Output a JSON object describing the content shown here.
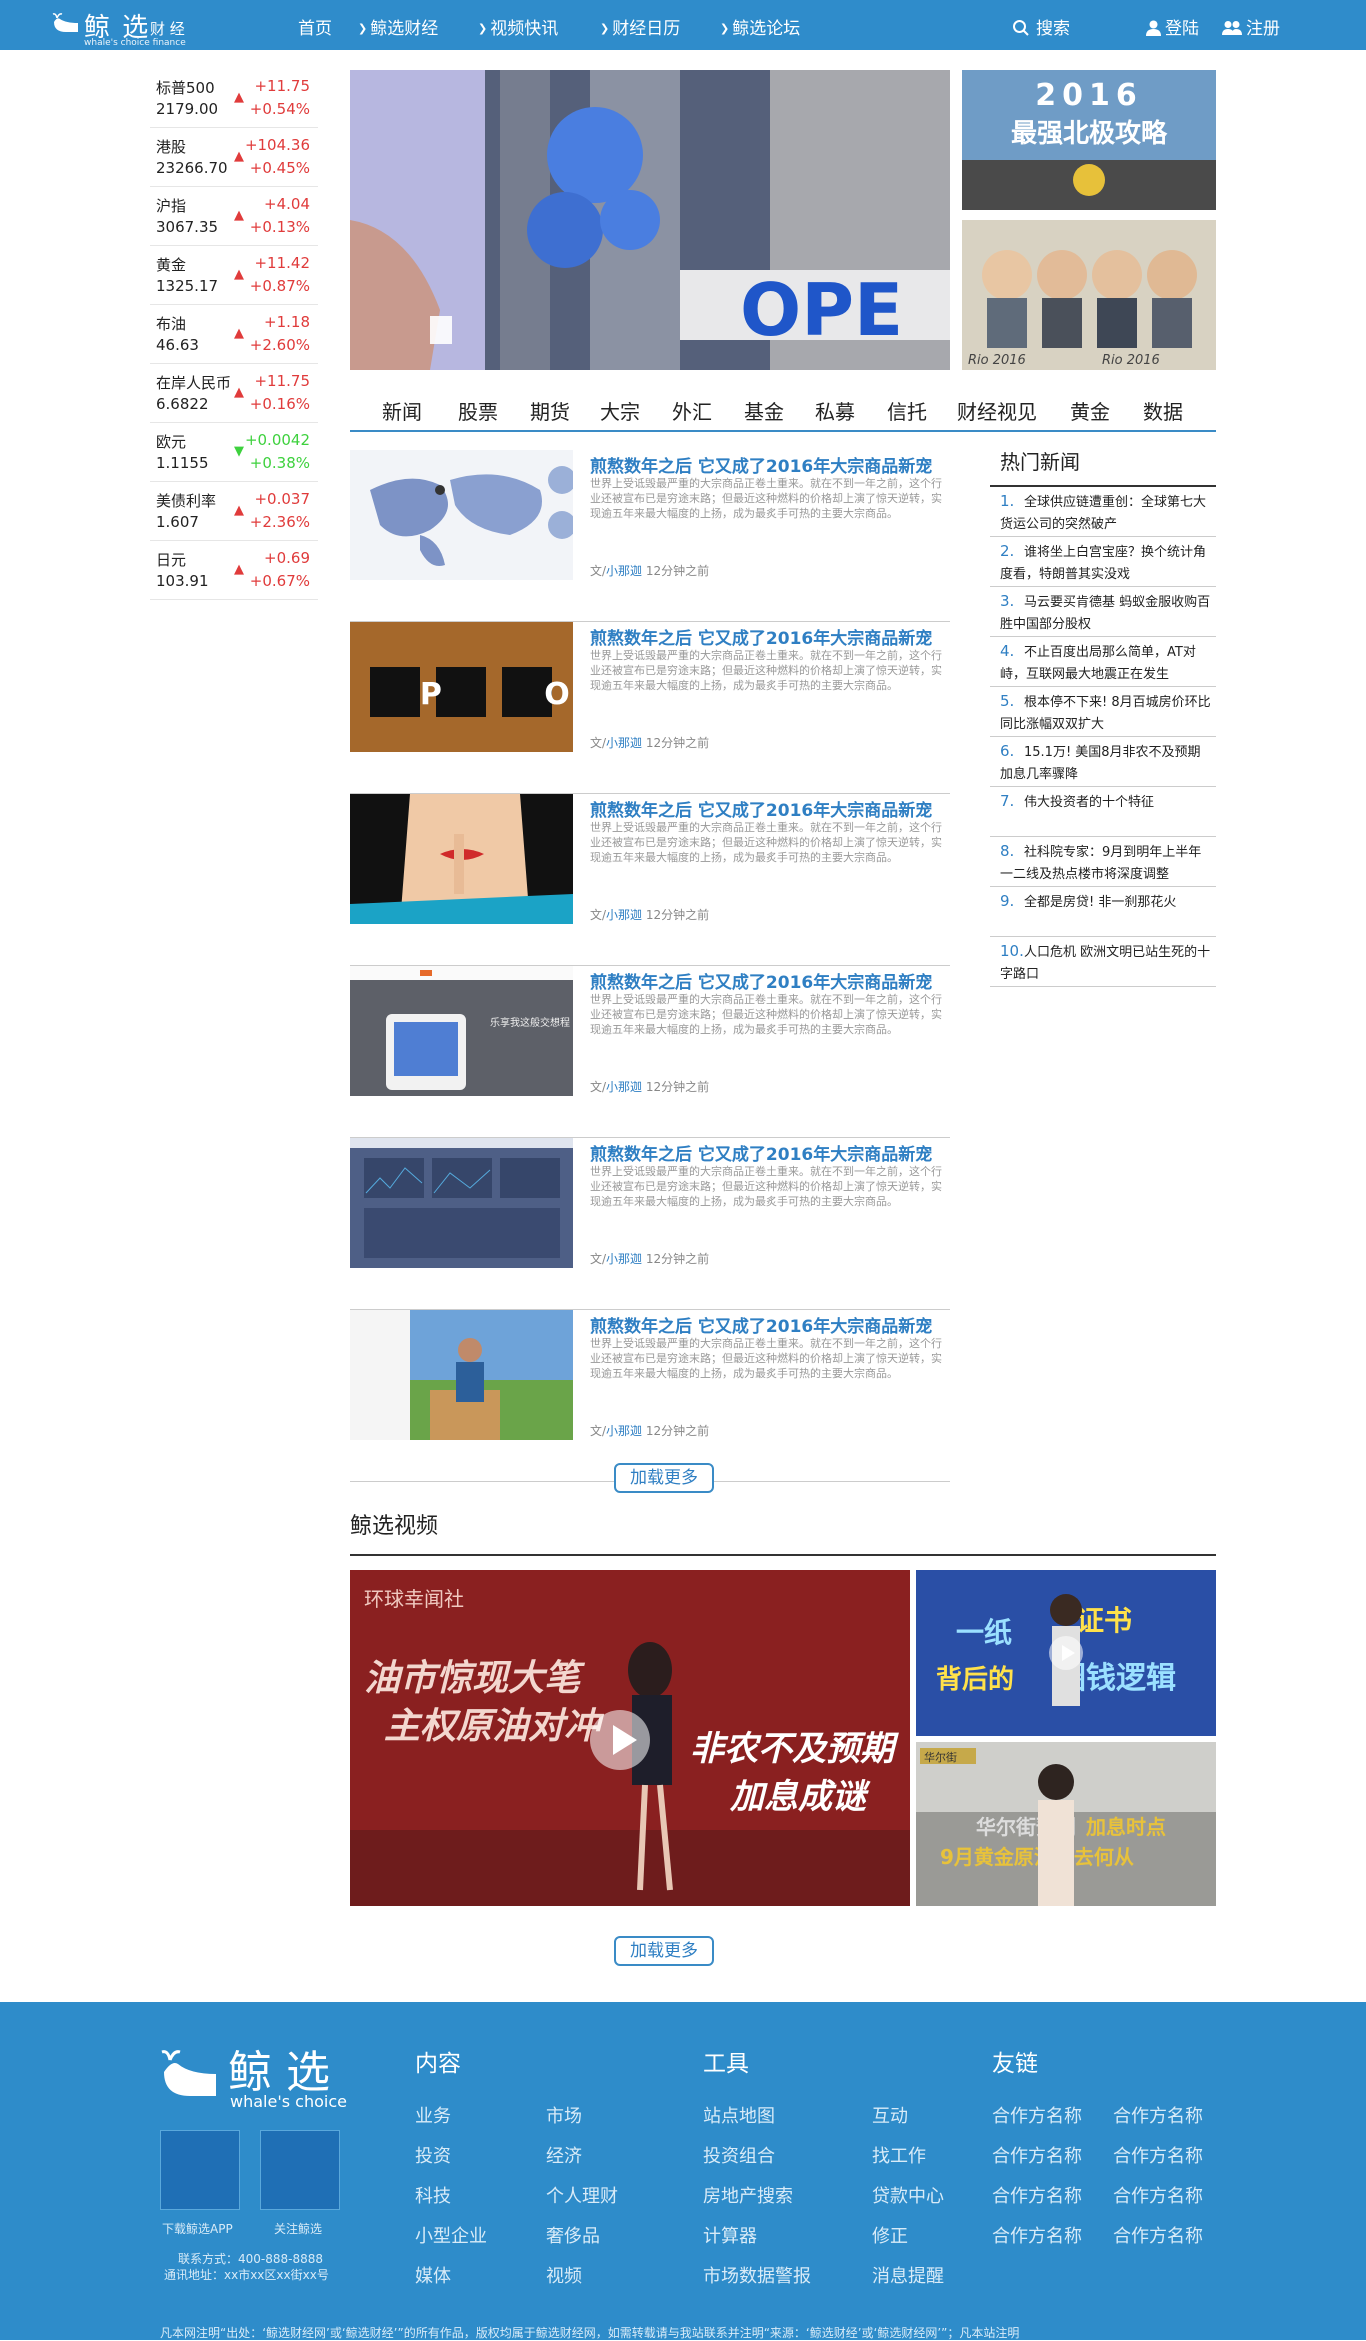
{
  "header": {
    "logo_cn": "鲸 选",
    "logo_sub": "财 经",
    "logo_en": "whale's choice finance",
    "nav": [
      "首页",
      "鲸选财经",
      "视频快讯",
      "财经日历",
      "鲸选论坛"
    ],
    "search": "搜索",
    "login": "登陆",
    "register": "注册"
  },
  "tickers": [
    {
      "name": "标普500",
      "price": "2179.00",
      "chg": "+11.75",
      "pct": "+0.54%",
      "dir": "up"
    },
    {
      "name": "港股",
      "price": "23266.70",
      "chg": "+104.36",
      "pct": "+0.45%",
      "dir": "up"
    },
    {
      "name": "沪指",
      "price": "3067.35",
      "chg": "+4.04",
      "pct": "+0.13%",
      "dir": "up"
    },
    {
      "name": "黄金",
      "price": "1325.17",
      "chg": "+11.42",
      "pct": "+0.87%",
      "dir": "up"
    },
    {
      "name": "布油",
      "price": "46.63",
      "chg": "+1.18",
      "pct": "+2.60%",
      "dir": "up"
    },
    {
      "name": "在岸人民币",
      "price": "6.6822",
      "chg": "+11.75",
      "pct": "+0.16%",
      "dir": "up"
    },
    {
      "name": "欧元",
      "price": "1.1155",
      "chg": "+0.0042",
      "pct": "+0.38%",
      "dir": "down"
    },
    {
      "name": "美债利率",
      "price": "1.607",
      "chg": "+0.037",
      "pct": "+2.36%",
      "dir": "up"
    },
    {
      "name": "日元",
      "price": "103.91",
      "chg": "+0.69",
      "pct": "+0.67%",
      "dir": "up"
    }
  ],
  "banner": {
    "main_text": "OPE",
    "side_top_text": "2016",
    "side_top_sub": "最强北极攻略",
    "side_bottom_text": "Rio 2016"
  },
  "categories": [
    "新闻",
    "股票",
    "期货",
    "大宗",
    "外汇",
    "基金",
    "私募",
    "信托",
    "财经视见",
    "黄金",
    "数据"
  ],
  "news": [
    {
      "title": "煎熬数年之后 它又成了2016年大宗商品新宠",
      "desc": "世界上受诋毁最严重的大宗商品正卷土重来。就在不到一年之前，这个行业还被宣布已是穷途末路；但最近这种燃料的价格却上演了惊天逆转，实现逾五年来最大幅度的上扬，成为最炙手可热的主要大宗商品。",
      "author_prefix": "文/",
      "author": "小那迦",
      "time": "12分钟之前"
    },
    {
      "title": "煎熬数年之后 它又成了2016年大宗商品新宠",
      "desc": "世界上受诋毁最严重的大宗商品正卷土重来。就在不到一年之前，这个行业还被宣布已是穷途末路；但最近这种燃料的价格却上演了惊天逆转，实现逾五年来最大幅度的上扬，成为最炙手可热的主要大宗商品。",
      "author_prefix": "文/",
      "author": "小那迦",
      "time": "12分钟之前"
    },
    {
      "title": "煎熬数年之后 它又成了2016年大宗商品新宠",
      "desc": "世界上受诋毁最严重的大宗商品正卷土重来。就在不到一年之前，这个行业还被宣布已是穷途末路；但最近这种燃料的价格却上演了惊天逆转，实现逾五年来最大幅度的上扬，成为最炙手可热的主要大宗商品。",
      "author_prefix": "文/",
      "author": "小那迦",
      "time": "12分钟之前"
    },
    {
      "title": "煎熬数年之后 它又成了2016年大宗商品新宠",
      "desc": "世界上受诋毁最严重的大宗商品正卷土重来。就在不到一年之前，这个行业还被宣布已是穷途末路；但最近这种燃料的价格却上演了惊天逆转，实现逾五年来最大幅度的上扬，成为最炙手可热的主要大宗商品。",
      "author_prefix": "文/",
      "author": "小那迦",
      "time": "12分钟之前"
    },
    {
      "title": "煎熬数年之后 它又成了2016年大宗商品新宠",
      "desc": "世界上受诋毁最严重的大宗商品正卷土重来。就在不到一年之前，这个行业还被宣布已是穷途末路；但最近这种燃料的价格却上演了惊天逆转，实现逾五年来最大幅度的上扬，成为最炙手可热的主要大宗商品。",
      "author_prefix": "文/",
      "author": "小那迦",
      "time": "12分钟之前"
    },
    {
      "title": "煎熬数年之后 它又成了2016年大宗商品新宠",
      "desc": "世界上受诋毁最严重的大宗商品正卷土重来。就在不到一年之前，这个行业还被宣布已是穷途末路；但最近这种燃料的价格却上演了惊天逆转，实现逾五年来最大幅度的上扬，成为最炙手可热的主要大宗商品。",
      "author_prefix": "文/",
      "author": "小那迦",
      "time": "12分钟之前"
    }
  ],
  "news_thumbs": {
    "ipo": "I P O",
    "site": "乐享我这般交想程"
  },
  "hot": {
    "title": "热门新闻",
    "items": [
      {
        "n": "1.",
        "text": "全球供应链遭重创：全球第七大货运公司的突然破产"
      },
      {
        "n": "2.",
        "text": "谁将坐上白宫宝座？换个统计角度看，特朗普其实没戏"
      },
      {
        "n": "3.",
        "text": "马云要买肯德基 蚂蚁金服收购百胜中国部分股权"
      },
      {
        "n": "4.",
        "text": "不止百度出局那么简单，AT对峙，互联网最大地震正在发生"
      },
      {
        "n": "5.",
        "text": "根本停不下来! 8月百城房价环比同比涨幅双双扩大"
      },
      {
        "n": "6.",
        "text": "15.1万! 美国8月非农不及预期 加息几率骤降"
      },
      {
        "n": "7.",
        "text": "伟大投资者的十个特征"
      },
      {
        "n": "8.",
        "text": "社科院专家：9月到明年上半年 一二线及热点楼市将深度调整"
      },
      {
        "n": "9.",
        "text": "全都是房贷! 非一刹那花火"
      },
      {
        "n": "10.",
        "text": "人口危机 欧洲文明已站生死的十字路口"
      }
    ]
  },
  "load_more": "加载更多",
  "video": {
    "title": "鲸选视频",
    "main_tag": "环球幸闻社",
    "main_l1": "油市惊现大笔",
    "main_l2": "主权原油对冲",
    "main_r1": "非农不及预期",
    "main_r2": "加息成谜",
    "side1_a": "一纸",
    "side1_b": "证书",
    "side1_c": "背后的",
    "side1_d": "圈钱逻辑",
    "side2_tag": "华尔街",
    "side2_a": "华尔街预判",
    "side2_b": "加息时点",
    "side2_c": "9月黄金原油何去何从"
  },
  "footer": {
    "logo_cn": "鲸 选",
    "logo_en": "whale's choice",
    "qr1": "下载鲸选APP",
    "qr2": "关注鲸选",
    "contact": "联系方式：400-888-8888",
    "address": "通讯地址：xx市xx区xx街xx号",
    "col1_title": "内容",
    "col1": [
      "业务",
      "投资",
      "科技",
      "小型企业",
      "媒体"
    ],
    "col1b": [
      "市场",
      "经济",
      "个人理财",
      "奢侈品",
      "视频"
    ],
    "col2_title": "工具",
    "col2": [
      "站点地图",
      "投资组合",
      "房地产搜索",
      "计算器",
      "市场数据警报"
    ],
    "col2b": [
      "互动",
      "找工作",
      "贷款中心",
      "修正",
      "消息提醒"
    ],
    "col3_title": "友链",
    "col3": [
      "合作方名称",
      "合作方名称",
      "合作方名称",
      "合作方名称"
    ],
    "col3b": [
      "合作方名称",
      "合作方名称",
      "合作方名称",
      "合作方名称"
    ],
    "copyright": "凡本网注明“出处：‘鲸选财经网’或‘鲸选财经’”的所有作品，版权均属于鲸选财经网，如需转载请与我站联系并注明“来源：‘鲸选财经’或‘鲸选财经网’”；凡本站注明"
  }
}
